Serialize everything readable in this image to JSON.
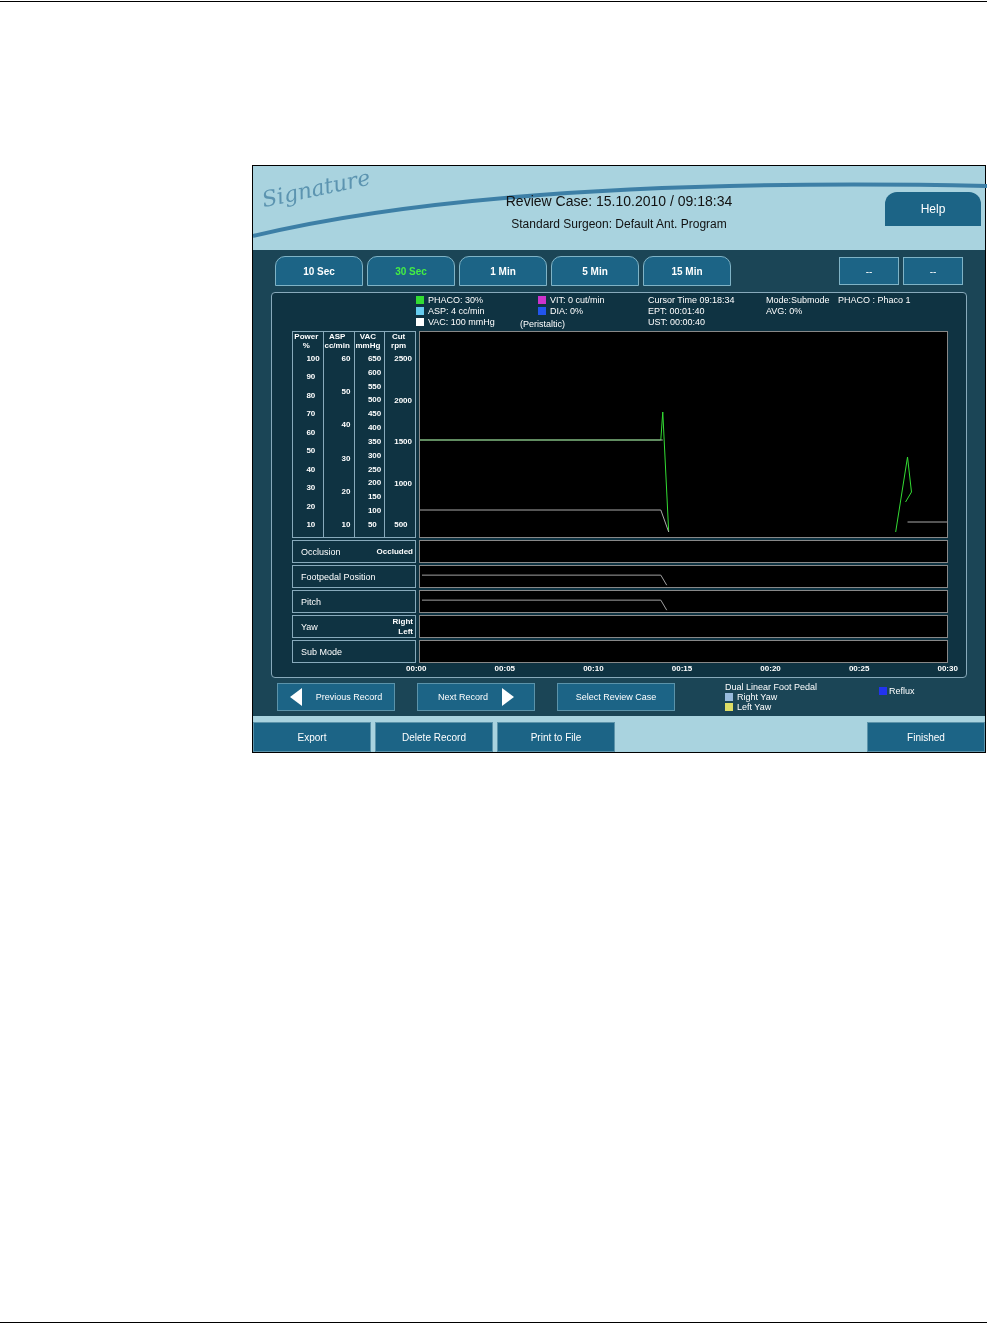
{
  "header": {
    "logo": "Signature",
    "title": "Review Case: 15.10.2010 / 09:18:34",
    "subtitle": "Standard Surgeon: Default Ant. Program",
    "help": "Help"
  },
  "tabs": [
    {
      "label": "10 Sec",
      "selected": false
    },
    {
      "label": "30 Sec",
      "selected": true
    },
    {
      "label": "1 Min",
      "selected": false
    },
    {
      "label": "5 Min",
      "selected": false
    },
    {
      "label": "15 Min",
      "selected": false
    }
  ],
  "nav_buttons": [
    "--",
    "--"
  ],
  "legend": [
    {
      "label": "PHACO:  30%",
      "color": "#33dd33"
    },
    {
      "label": "ASP:  4 cc/min",
      "color": "#66ccee"
    },
    {
      "label": "VAC:  100 mmHg",
      "color": "#ffffff"
    },
    {
      "label": "VIT:  0 cut/min",
      "color": "#cc33cc"
    },
    {
      "label": "DIA:  0%",
      "color": "#2255ee"
    }
  ],
  "pump": "(Peristaltic)",
  "times": [
    "Cursor Time  09:18:34",
    "EPT:  00:01:40",
    "UST:  00:00:40"
  ],
  "mode": [
    "Mode:Submode",
    "PHACO : Phaco 1",
    "AVG: 0%"
  ],
  "scales": [
    {
      "title": "Power %",
      "ticks": [
        "100",
        "90",
        "80",
        "70",
        "60",
        "50",
        "40",
        "30",
        "20",
        "10"
      ]
    },
    {
      "title": "ASP cc/min",
      "ticks": [
        "60",
        "50",
        "40",
        "30",
        "20",
        "10"
      ]
    },
    {
      "title": "VAC mmHg",
      "ticks": [
        "650",
        "600",
        "550",
        "500",
        "450",
        "400",
        "350",
        "300",
        "250",
        "200",
        "150",
        "100",
        "50"
      ]
    },
    {
      "title": "Cut rpm",
      "ticks": [
        "2500",
        "2000",
        "1500",
        "1000",
        "500"
      ]
    }
  ],
  "strips": [
    {
      "label": "Occlusion",
      "marks": [
        "Occluded"
      ]
    },
    {
      "label": "Footpedal Position"
    },
    {
      "label": "Pitch"
    },
    {
      "label": "Yaw",
      "marks": [
        "Right",
        "Left"
      ]
    },
    {
      "label": "Sub Mode"
    }
  ],
  "x_labels": [
    "00:00",
    "00:05",
    "00:10",
    "00:15",
    "00:20",
    "00:25",
    "00:30"
  ],
  "record_buttons": [
    {
      "label": "Previous Record",
      "kind": "prev"
    },
    {
      "label": "Next Record",
      "kind": "next"
    },
    {
      "label": "Select Review Case",
      "kind": "plain"
    }
  ],
  "pedal_legend": {
    "title": "Dual Linear Foot Pedal",
    "items": [
      {
        "label": "Right Yaw",
        "color": "#99bbdd"
      },
      {
        "label": "Left Yaw",
        "color": "#dddd66"
      }
    ],
    "reflux": {
      "label": "Reflux",
      "color": "#2233ee"
    }
  },
  "footer": [
    "Export",
    "Delete Record",
    "Print to File",
    "Finished"
  ]
}
